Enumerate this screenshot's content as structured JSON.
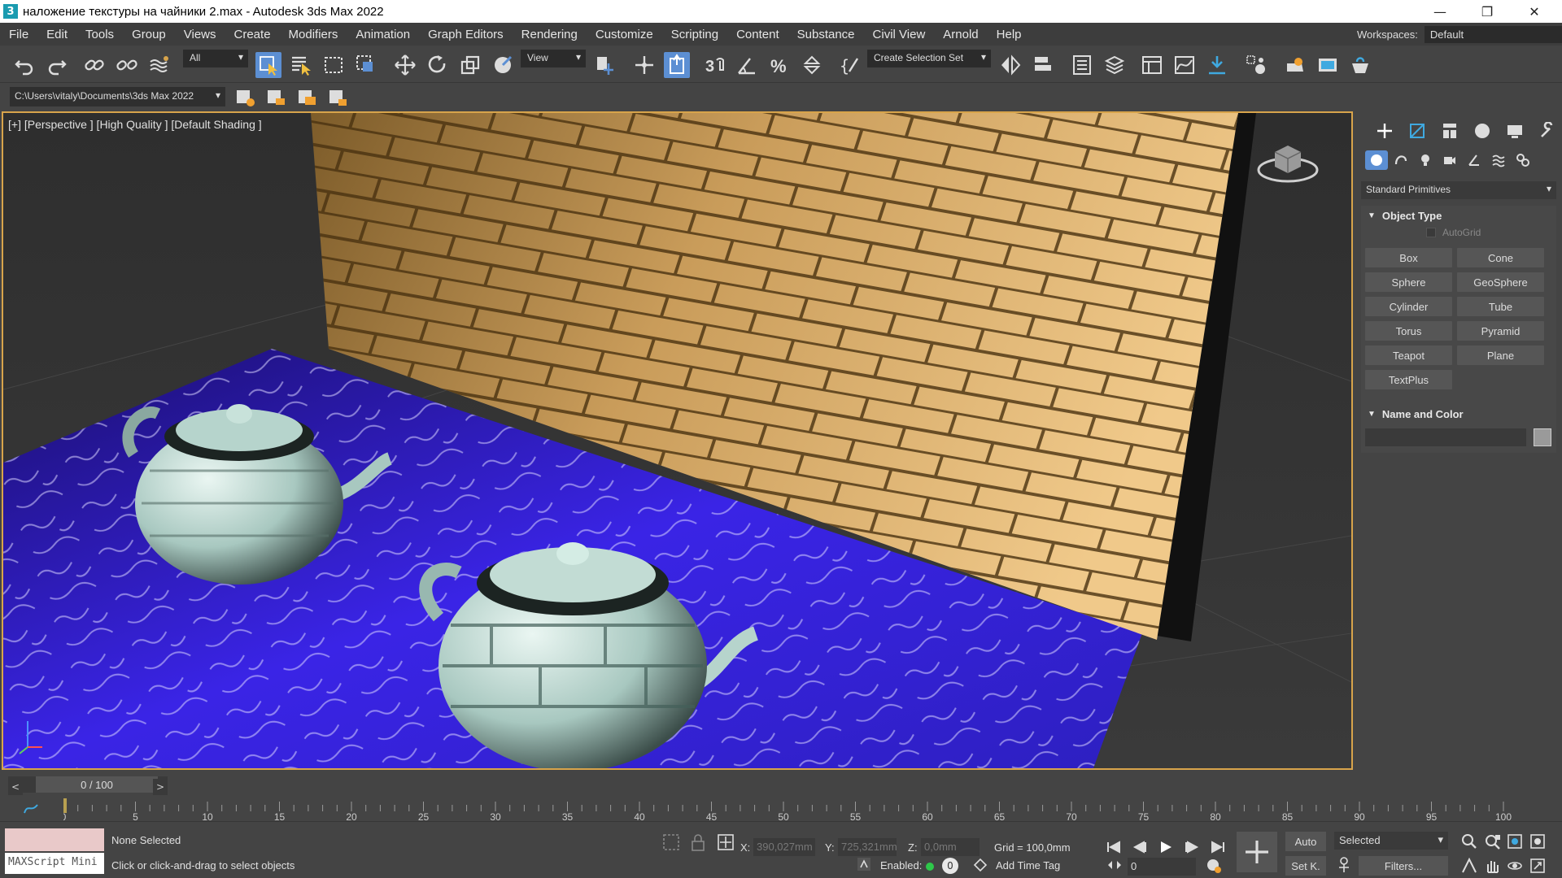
{
  "window": {
    "title": "наложение текстуры на чайники 2.max - Autodesk 3ds Max 2022",
    "app_icon_letter": "3",
    "controls": [
      "—",
      "❐",
      "✕"
    ]
  },
  "menu": {
    "items": [
      "File",
      "Edit",
      "Tools",
      "Group",
      "Views",
      "Create",
      "Modifiers",
      "Animation",
      "Graph Editors",
      "Rendering",
      "Customize",
      "Scripting",
      "Content",
      "Substance",
      "Civil View",
      "Arnold",
      "Help"
    ],
    "workspaces_label": "Workspaces:",
    "workspace_value": "Default"
  },
  "toolbar": {
    "selection_filter": "All",
    "reference_coord": "View",
    "named_selection": "Create Selection Set",
    "path": "C:\\Users\\vitaly\\Documents\\3ds Max 2022"
  },
  "viewport": {
    "label": "[+] [Perspective ] [High Quality ] [Default Shading ]"
  },
  "command_panel": {
    "category": "Standard Primitives",
    "object_type_title": "Object Type",
    "autogrid_label": "AutoGrid",
    "primitives": [
      "Box",
      "Cone",
      "Sphere",
      "GeoSphere",
      "Cylinder",
      "Tube",
      "Torus",
      "Pyramid",
      "Teapot",
      "Plane",
      "TextPlus"
    ],
    "name_color_title": "Name and Color"
  },
  "timeline": {
    "frame_display": "0 / 100",
    "prev": "<",
    "next": ">",
    "ticks": [
      "0",
      "5",
      "10",
      "15",
      "20",
      "25",
      "30",
      "35",
      "40",
      "45",
      "50",
      "55",
      "60",
      "65",
      "70",
      "75",
      "80",
      "85",
      "90",
      "95",
      "100"
    ]
  },
  "status": {
    "maxscript_label": "MAXScript Mini",
    "selection": "None Selected",
    "prompt": "Click or click-and-drag to select objects",
    "x_label": "X:",
    "x_value": "390,027mm",
    "y_label": "Y:",
    "y_value": "725,321mm",
    "z_label": "Z:",
    "z_value": "0,0mm",
    "grid": "Grid = 100,0mm",
    "enabled_label": "Enabled:",
    "enabled_value": "0",
    "add_time_tag": "Add Time Tag",
    "auto_key": "Auto",
    "set_key": "Set K.",
    "key_mode": "Selected",
    "frame_value": "0",
    "filters": "Filters..."
  },
  "colors": {
    "accent": "#5c8fd3",
    "viewport_border": "#d8a44b",
    "floor_blue": "#3b26e0",
    "brick_gold": "#c89a52"
  }
}
